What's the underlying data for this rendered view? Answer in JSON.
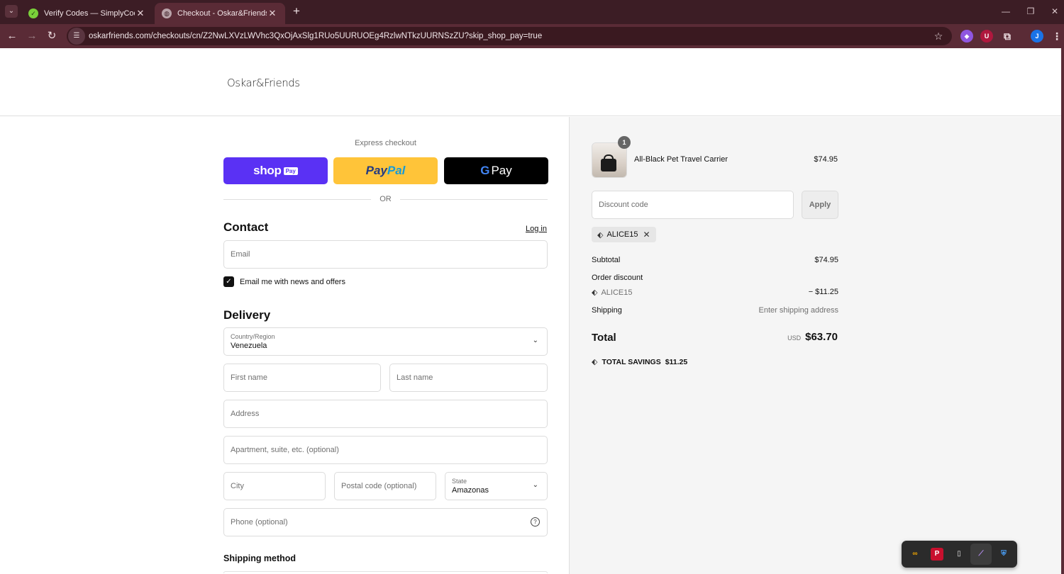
{
  "browser": {
    "tabs": [
      {
        "title": "Verify Codes — SimplyCodes",
        "active": false
      },
      {
        "title": "Checkout - Oskar&Friends",
        "active": true
      }
    ],
    "url": "oskarfriends.com/checkouts/cn/Z2NwLXVzLWVhc3QxOjAxSlg1RUo5UURUOEg4RzlwNTkzUURNSzZU?skip_shop_pay=true",
    "profile_initial": "J"
  },
  "header": {
    "brand": "Oskar&Friends"
  },
  "express": {
    "title": "Express checkout",
    "shop_label": "shop",
    "shop_chip": "Pay",
    "paypal_a": "Pay",
    "paypal_b": "Pal",
    "gpay_label": "Pay",
    "or_label": "OR"
  },
  "contact": {
    "title": "Contact",
    "login_label": "Log in",
    "email_placeholder": "Email",
    "newsletter_label": "Email me with news and offers",
    "newsletter_checked": true
  },
  "delivery": {
    "title": "Delivery",
    "country_label": "Country/Region",
    "country_value": "Venezuela",
    "first_name_placeholder": "First name",
    "last_name_placeholder": "Last name",
    "address_placeholder": "Address",
    "apartment_placeholder": "Apartment, suite, etc. (optional)",
    "city_placeholder": "City",
    "postal_placeholder": "Postal code (optional)",
    "state_label": "State",
    "state_value": "Amazonas",
    "phone_placeholder": "Phone (optional)"
  },
  "shipping_method": {
    "title": "Shipping method"
  },
  "order": {
    "item": {
      "name": "All-Black Pet Travel Carrier",
      "price": "$74.95",
      "quantity": "1"
    },
    "discount_placeholder": "Discount code",
    "apply_label": "Apply",
    "applied_code": "ALICE15",
    "subtotal_label": "Subtotal",
    "subtotal_value": "$74.95",
    "order_discount_label": "Order discount",
    "discount_code_line": "ALICE15",
    "discount_value": "− $11.25",
    "shipping_label": "Shipping",
    "shipping_value": "Enter shipping address",
    "total_label": "Total",
    "total_currency": "USD",
    "total_value": "$63.70",
    "savings_label": "TOTAL SAVINGS",
    "savings_value": "$11.25"
  },
  "colors": {
    "shop_pay": "#5a31f4",
    "paypal": "#ffc439",
    "gpay": "#000000",
    "browser_frame": "#3c1d25"
  }
}
